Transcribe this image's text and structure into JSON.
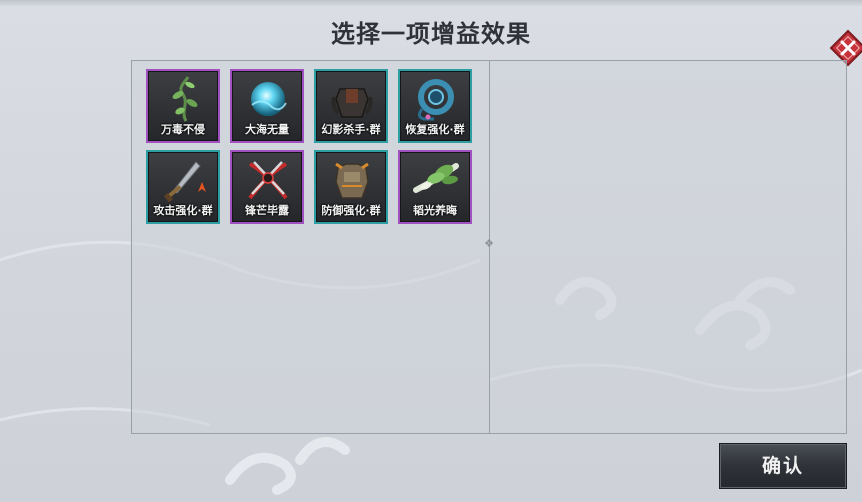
{
  "dialog": {
    "title": "选择一项增益效果",
    "confirm_label": "确认"
  },
  "buffs": [
    {
      "label": "万毒不侵",
      "rarity_color": "#a150c0",
      "icon": "poison-vine-icon"
    },
    {
      "label": "大海无量",
      "rarity_color": "#a150c0",
      "icon": "water-orb-icon"
    },
    {
      "label": "幻影杀手·群",
      "rarity_color": "#2d9ea2",
      "icon": "shadow-armor-icon"
    },
    {
      "label": "恢复强化·群",
      "rarity_color": "#2d9ea2",
      "icon": "healing-ring-icon"
    },
    {
      "label": "攻击强化·群",
      "rarity_color": "#2d9ea2",
      "icon": "sword-icon"
    },
    {
      "label": "锋芒毕露",
      "rarity_color": "#a150c0",
      "icon": "crossed-blades-icon"
    },
    {
      "label": "防御强化·群",
      "rarity_color": "#2d9ea2",
      "icon": "shield-armor-icon"
    },
    {
      "label": "韬光养晦",
      "rarity_color": "#a150c0",
      "icon": "herb-icon"
    }
  ]
}
